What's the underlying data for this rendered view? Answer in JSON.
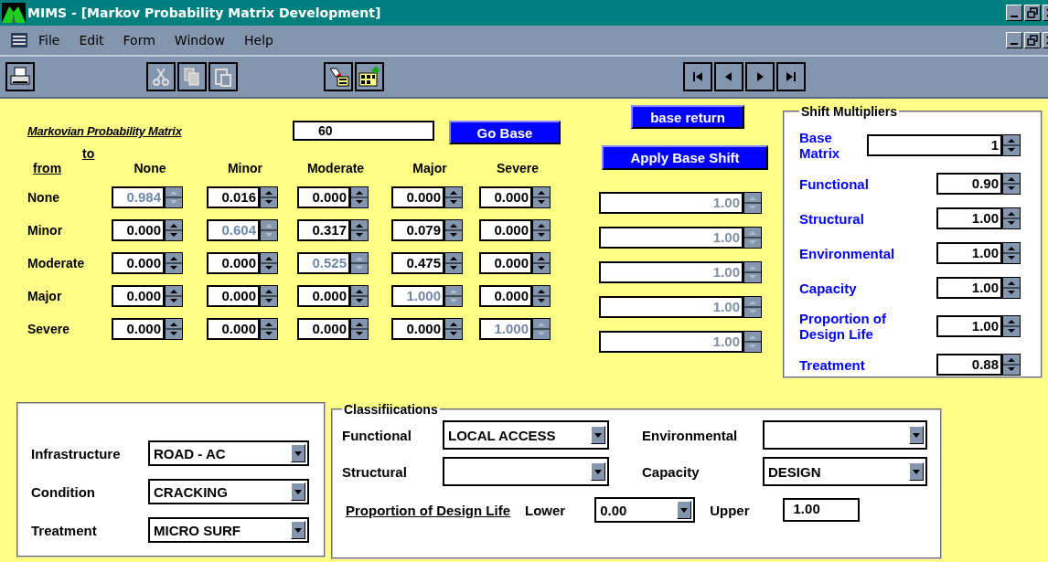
{
  "window": {
    "title": "MIMS - [Markov Probability Matrix Development]"
  },
  "menu": [
    {
      "label": "File"
    },
    {
      "label": "Edit"
    },
    {
      "label": "Form"
    },
    {
      "label": "Window"
    },
    {
      "label": "Help"
    }
  ],
  "matrix": {
    "title": "Markovian Probability Matrix",
    "value": "60",
    "go_button": "Go Base",
    "to_label": "to",
    "from_label": "from",
    "columns": [
      "None",
      "Minor",
      "Moderate",
      "Major",
      "Severe"
    ],
    "rows": [
      {
        "label": "None",
        "cells": [
          {
            "value": "0.984",
            "disabled": true
          },
          {
            "value": "0.016",
            "disabled": false
          },
          {
            "value": "0.000",
            "disabled": false
          },
          {
            "value": "0.000",
            "disabled": false
          },
          {
            "value": "0.000",
            "disabled": false
          }
        ]
      },
      {
        "label": "Minor",
        "cells": [
          {
            "value": "0.000",
            "disabled": false
          },
          {
            "value": "0.604",
            "disabled": true
          },
          {
            "value": "0.317",
            "disabled": false
          },
          {
            "value": "0.079",
            "disabled": false
          },
          {
            "value": "0.000",
            "disabled": false
          }
        ]
      },
      {
        "label": "Moderate",
        "cells": [
          {
            "value": "0.000",
            "disabled": false
          },
          {
            "value": "0.000",
            "disabled": false
          },
          {
            "value": "0.525",
            "disabled": true
          },
          {
            "value": "0.475",
            "disabled": false
          },
          {
            "value": "0.000",
            "disabled": false
          }
        ]
      },
      {
        "label": "Major",
        "cells": [
          {
            "value": "0.000",
            "disabled": false
          },
          {
            "value": "0.000",
            "disabled": false
          },
          {
            "value": "0.000",
            "disabled": false
          },
          {
            "value": "1.000",
            "disabled": true
          },
          {
            "value": "0.000",
            "disabled": false
          }
        ]
      },
      {
        "label": "Severe",
        "cells": [
          {
            "value": "0.000",
            "disabled": false
          },
          {
            "value": "0.000",
            "disabled": false
          },
          {
            "value": "0.000",
            "disabled": false
          },
          {
            "value": "0.000",
            "disabled": false
          },
          {
            "value": "1.000",
            "disabled": true
          }
        ]
      }
    ]
  },
  "shift_controls": {
    "base_return_button": "base return",
    "apply_button": "Apply Base Shift",
    "row_factors": [
      {
        "value": "1.00",
        "disabled": true
      },
      {
        "value": "1.00",
        "disabled": true
      },
      {
        "value": "1.00",
        "disabled": true
      },
      {
        "value": "1.00",
        "disabled": true
      },
      {
        "value": "1.00",
        "disabled": true
      }
    ]
  },
  "shift_multipliers": {
    "title": "Shift Multipliers",
    "items": [
      {
        "label": "Base Matrix",
        "value": "1",
        "kind": "wide"
      },
      {
        "label": "Functional",
        "value": "0.90",
        "kind": "narrow"
      },
      {
        "label": "Structural",
        "value": "1.00",
        "kind": "narrow"
      },
      {
        "label": "Environmental",
        "value": "1.00",
        "kind": "narrow"
      },
      {
        "label": "Capacity",
        "value": "1.00",
        "kind": "narrow"
      },
      {
        "label": "Proportion of Design Life",
        "value": "1.00",
        "kind": "narrow"
      },
      {
        "label": "Treatment",
        "value": "0.88",
        "kind": "narrow"
      }
    ]
  },
  "asset": [
    {
      "label": "Infrastructure",
      "value": "ROAD - AC"
    },
    {
      "label": "Condition",
      "value": "CRACKING"
    },
    {
      "label": "Treatment",
      "value": "MICRO SURF"
    }
  ],
  "classifications": {
    "title": "Classifiications",
    "fields": [
      {
        "label": "Functional",
        "value": "LOCAL ACCESS"
      },
      {
        "label": "Environmental"
      },
      {
        "label": "Structural"
      },
      {
        "label": "Capacity",
        "value": "DESIGN"
      }
    ],
    "design_life": {
      "label": "Proportion of Design Life",
      "lower_label": "Lower",
      "lower_value": "0.00",
      "upper_label": "Upper",
      "upper_value": "1.00"
    }
  }
}
